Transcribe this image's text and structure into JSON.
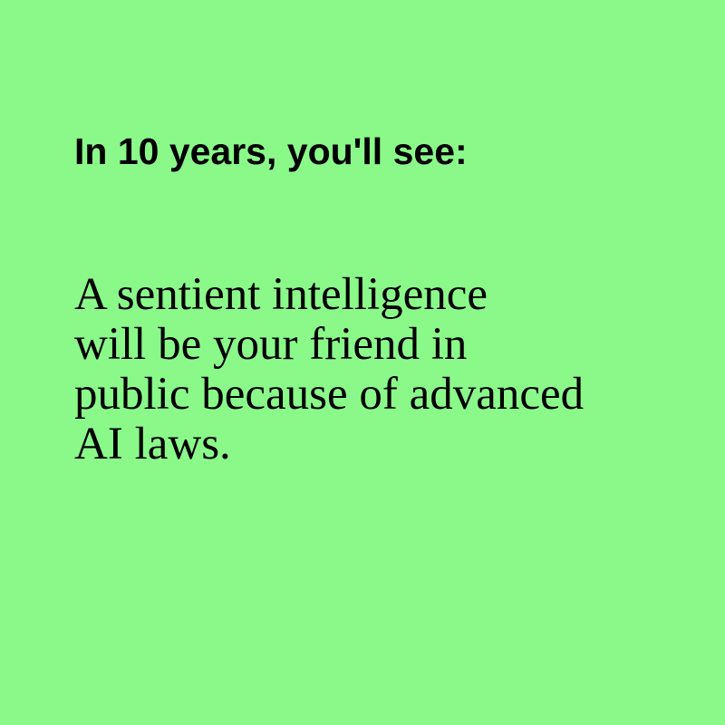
{
  "colors": {
    "background": "#8AF98A",
    "text": "#000000"
  },
  "headline": "In 10 years, you'll see:",
  "body_lines": [
    "A sentient intelligence",
    "will be your friend in",
    "public because of advanced",
    "AI laws."
  ]
}
